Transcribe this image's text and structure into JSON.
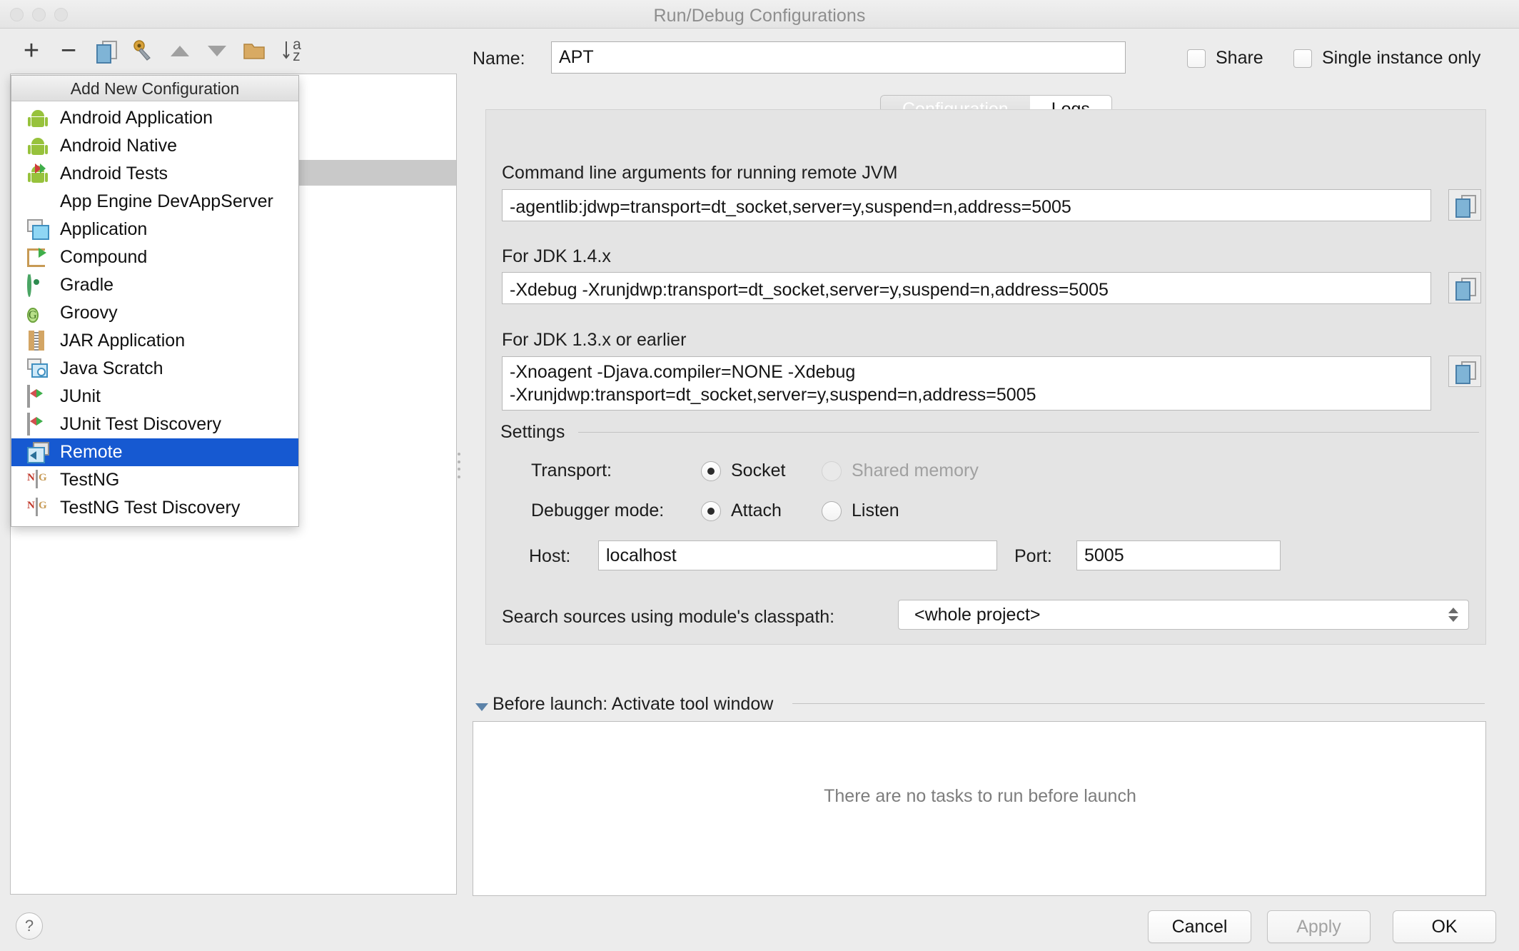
{
  "window": {
    "title": "Run/Debug Configurations"
  },
  "toolbar": {
    "add": "+",
    "remove": "−",
    "copy_icon": "copy-configuration-icon",
    "edit_templates_icon": "edit-templates-icon",
    "move_up_icon": "move-up-icon",
    "move_down_icon": "move-down-icon",
    "folder_icon": "new-folder-icon",
    "sort_icon": "sort-alphabetically-icon",
    "sort_label_top": "a",
    "sort_label_bottom": "z"
  },
  "popup": {
    "header": "Add New Configuration",
    "items": [
      {
        "label": "Android Application",
        "icon": "android-icon",
        "selected": false
      },
      {
        "label": "Android Native",
        "icon": "android-icon",
        "selected": false
      },
      {
        "label": "Android Tests",
        "icon": "android-tests-icon",
        "selected": false
      },
      {
        "label": "App Engine DevAppServer",
        "icon": "app-engine-icon",
        "selected": false
      },
      {
        "label": "Application",
        "icon": "application-icon",
        "selected": false
      },
      {
        "label": "Compound",
        "icon": "compound-icon",
        "selected": false
      },
      {
        "label": "Gradle",
        "icon": "gradle-icon",
        "selected": false
      },
      {
        "label": "Groovy",
        "icon": "groovy-icon",
        "selected": false
      },
      {
        "label": "JAR Application",
        "icon": "jar-icon",
        "selected": false
      },
      {
        "label": "Java Scratch",
        "icon": "java-scratch-icon",
        "selected": false
      },
      {
        "label": "JUnit",
        "icon": "junit-icon",
        "selected": false
      },
      {
        "label": "JUnit Test Discovery",
        "icon": "junit-icon",
        "selected": false
      },
      {
        "label": "Remote",
        "icon": "remote-icon",
        "selected": true
      },
      {
        "label": "TestNG",
        "icon": "testng-icon",
        "selected": false
      },
      {
        "label": "TestNG Test Discovery",
        "icon": "testng-icon",
        "selected": false
      }
    ],
    "selection_color": "#1659d1"
  },
  "header": {
    "name_label": "Name:",
    "name_value": "APT",
    "share_label": "Share",
    "share_checked": false,
    "single_instance_label": "Single instance only",
    "single_instance_checked": false
  },
  "tabs": [
    {
      "label": "Configuration",
      "active": false
    },
    {
      "label": "Logs",
      "active": true
    }
  ],
  "logs": {
    "jvm_args_label": "Command line arguments for running remote JVM",
    "jvm_args_value": "-agentlib:jdwp=transport=dt_socket,server=y,suspend=n,address=5005",
    "jdk14_label": "For JDK 1.4.x",
    "jdk14_value": "-Xdebug -Xrunjdwp:transport=dt_socket,server=y,suspend=n,address=5005",
    "jdk13_label": "For JDK 1.3.x or earlier",
    "jdk13_value_line1": "-Xnoagent -Djava.compiler=NONE -Xdebug",
    "jdk13_value_line2": "-Xrunjdwp:transport=dt_socket,server=y,suspend=n,address=5005",
    "copy_button_icon": "copy-icon",
    "settings_title": "Settings",
    "transport_label": "Transport:",
    "transport_socket": "Socket",
    "transport_socket_selected": true,
    "transport_shared": "Shared memory",
    "transport_shared_selected": false,
    "transport_shared_disabled": true,
    "debugger_mode_label": "Debugger mode:",
    "debugger_attach": "Attach",
    "debugger_attach_selected": true,
    "debugger_listen": "Listen",
    "debugger_listen_selected": false,
    "host_label": "Host:",
    "host_value": "localhost",
    "port_label": "Port:",
    "port_value": "5005",
    "classpath_label": "Search sources using module's classpath:",
    "classpath_value": "<whole project>"
  },
  "before_launch": {
    "title": "Before launch: Activate tool window",
    "empty_text": "There are no tasks to run before launch",
    "expanded": true
  },
  "footer": {
    "help": "?",
    "cancel": "Cancel",
    "apply": "Apply",
    "apply_disabled": true,
    "ok": "OK"
  }
}
